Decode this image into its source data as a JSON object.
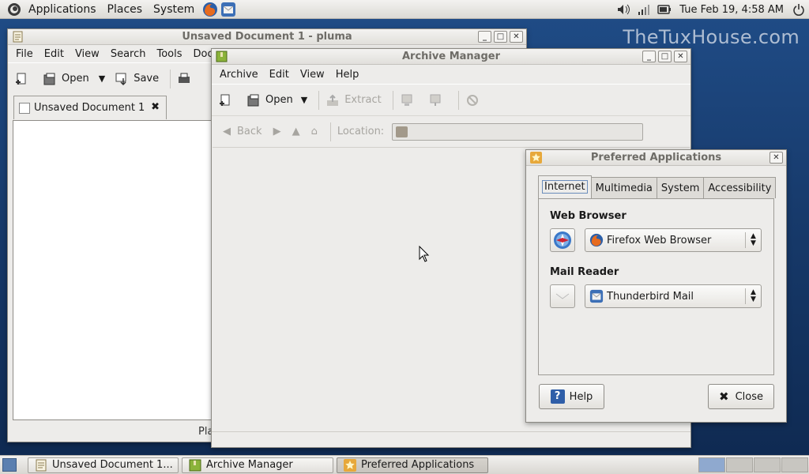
{
  "top_panel": {
    "menus": [
      "Applications",
      "Places",
      "System"
    ],
    "clock": "Tue Feb 19,  4:58 AM",
    "launchers": [
      "firefox-icon",
      "thunderbird-icon"
    ],
    "tray_icons": [
      "volume-icon",
      "network-signal-icon",
      "battery-icon",
      "power-icon"
    ]
  },
  "watermark": "TheTuxHouse.com",
  "pluma": {
    "title": "Unsaved Document 1 - pluma",
    "menu": [
      "File",
      "Edit",
      "View",
      "Search",
      "Tools",
      "Docu"
    ],
    "toolbar": {
      "open": "Open",
      "save": "Save"
    },
    "tab_label": "Unsaved Document 1",
    "status_fragment": "Pla"
  },
  "archive": {
    "title": "Archive Manager",
    "menu": [
      "Archive",
      "Edit",
      "View",
      "Help"
    ],
    "toolbar": {
      "open": "Open",
      "extract": "Extract"
    },
    "nav": {
      "back": "Back",
      "location_label": "Location:"
    }
  },
  "prefs": {
    "title": "Preferred Applications",
    "tabs": [
      "Internet",
      "Multimedia",
      "System",
      "Accessibility"
    ],
    "active_tab": "Internet",
    "web_browser": {
      "label": "Web Browser",
      "selected": "Firefox Web Browser"
    },
    "mail_reader": {
      "label": "Mail Reader",
      "selected": "Thunderbird Mail"
    },
    "buttons": {
      "help": "Help",
      "close": "Close"
    }
  },
  "taskbar": {
    "tasks": [
      "Unsaved Document 1...",
      "Archive Manager",
      "Preferred Applications"
    ],
    "active_task": "Preferred Applications"
  }
}
